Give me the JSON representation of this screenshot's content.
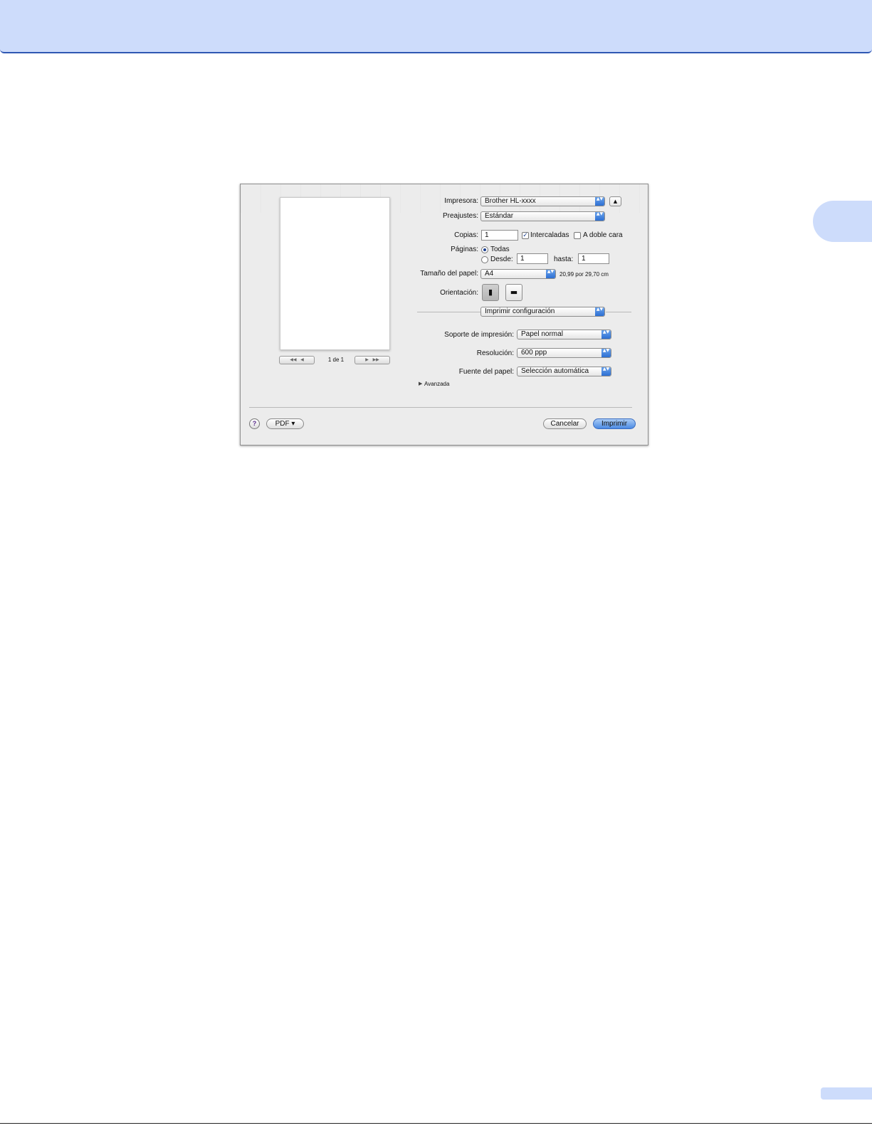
{
  "dialog": {
    "pager": {
      "first_icon": "◀◀",
      "prev_icon": "◀",
      "label": "1 de 1",
      "next_icon": "▶",
      "last_icon": "▶▶"
    },
    "printer": {
      "label": "Impresora:",
      "value": "Brother HL-xxxx",
      "collapse_icon": "▲"
    },
    "presets": {
      "label": "Preajustes:",
      "value": "Estándar"
    },
    "copies": {
      "label": "Copias:",
      "value": "1",
      "collated": {
        "label": "Intercaladas",
        "checked": true,
        "check_mark": "✓"
      },
      "duplex": {
        "label": "A doble cara",
        "checked": false
      }
    },
    "pages": {
      "label": "Páginas:",
      "all_label": "Todas",
      "from_label": "Desde:",
      "from_value": "1",
      "to_label": "hasta:",
      "to_value": "1",
      "selected": "all"
    },
    "paper_size": {
      "label": "Tamaño del papel:",
      "value": "A4",
      "dimensions": "20,99 por 29,70 cm"
    },
    "orientation": {
      "label": "Orientación:",
      "portrait_icon": "▮",
      "landscape_icon": "▬",
      "selected": "portrait"
    },
    "panel_menu": {
      "value": "Imprimir configuración"
    },
    "media_type": {
      "label": "Soporte de impresión:",
      "value": "Papel normal"
    },
    "resolution": {
      "label": "Resolución:",
      "value": "600 ppp"
    },
    "paper_source": {
      "label": "Fuente del papel:",
      "value": "Selección automática"
    },
    "advanced": {
      "label": "Avanzada",
      "icon": "▶"
    },
    "help_label": "?",
    "pdf_label": "PDF ▾",
    "cancel_label": "Cancelar",
    "print_label": "Imprimir",
    "popup_arrows": "▲▼"
  }
}
